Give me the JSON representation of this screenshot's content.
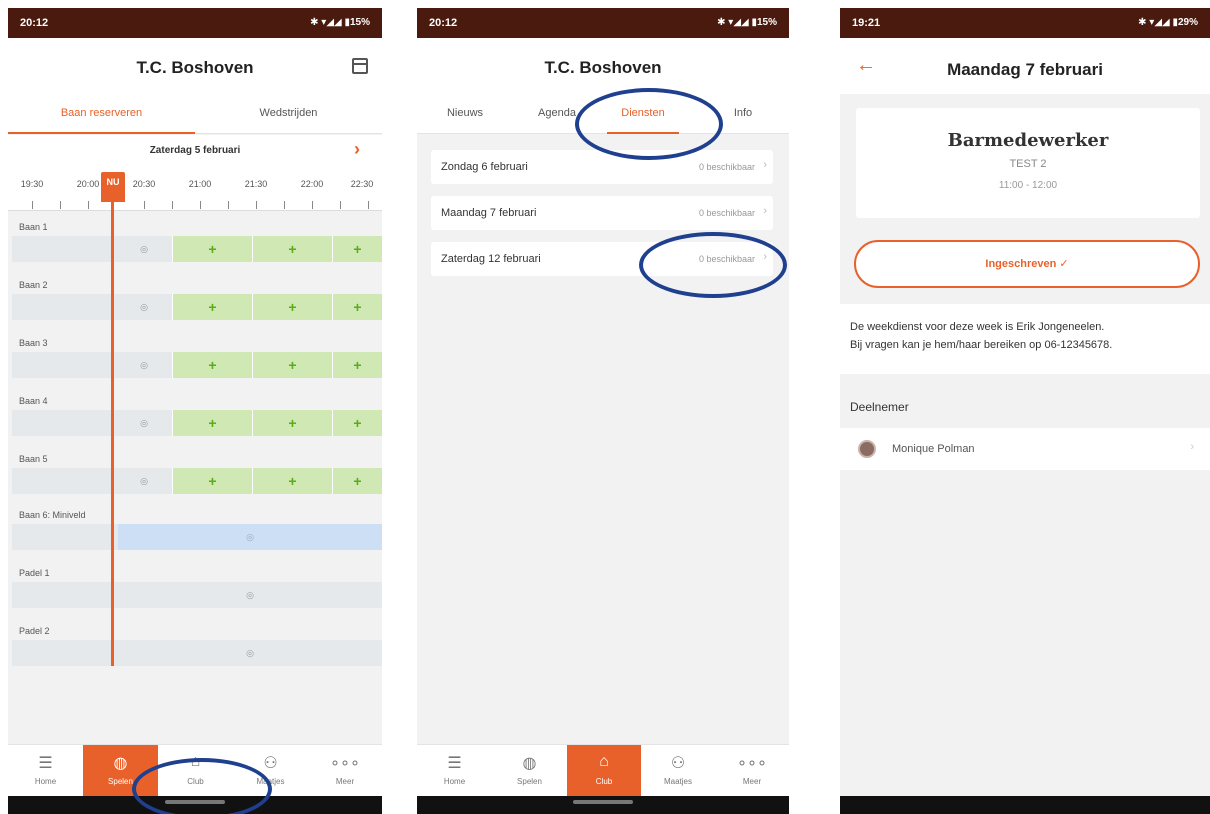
{
  "phone1": {
    "status": {
      "time": "20:12",
      "icons": "✱ ▾◢◢ ▮15%"
    },
    "title": "T.C. Boshoven",
    "tabs": [
      "Baan reserveren",
      "Wedstrijden"
    ],
    "date": "Zaterdag 5 februari",
    "times": [
      "19:30",
      "20:00",
      "20:30",
      "21:00",
      "21:30",
      "22:00",
      "22:30"
    ],
    "now_label": "NU",
    "courts": [
      "Baan 1",
      "Baan 2",
      "Baan 3",
      "Baan 4",
      "Baan 5",
      "Baan 6: Miniveld",
      "Padel 1",
      "Padel 2"
    ],
    "nav": [
      "Home",
      "Spelen",
      "Club",
      "Maatjes",
      "Meer"
    ]
  },
  "phone2": {
    "status": {
      "time": "20:12",
      "icons": "✱ ▾◢◢ ▮15%"
    },
    "title": "T.C. Boshoven",
    "tabs": [
      "Nieuws",
      "Agenda",
      "Diensten",
      "Info"
    ],
    "rows": [
      {
        "date": "Zondag 6 februari",
        "badge": "0 beschikbaar"
      },
      {
        "date": "Maandag 7 februari",
        "badge": "0 beschikbaar"
      },
      {
        "date": "Zaterdag 12 februari",
        "badge": "0 beschikbaar"
      }
    ],
    "nav": [
      "Home",
      "Spelen",
      "Club",
      "Maatjes",
      "Meer"
    ]
  },
  "phone3": {
    "status": {
      "time": "19:21",
      "icons": "✱ ▾◢◢ ▮29%"
    },
    "title": "Maandag 7 februari",
    "card": {
      "role": "Barmedewerker",
      "sub": "TEST 2",
      "time": "11:00 - 12:00"
    },
    "signed_label": "Ingeschreven ✓",
    "info_line1": "De weekdienst voor deze week is Erik Jongeneelen.",
    "info_line2": "Bij vragen kan je hem/haar bereiken op 06-12345678.",
    "section": "Deelnemer",
    "participant": "Monique Polman"
  },
  "colors": {
    "accent": "#e8612a",
    "statusbar": "#4a1a0e",
    "highlight_circle": "#1f3f8f",
    "slot_green": "#cfe8b4"
  }
}
